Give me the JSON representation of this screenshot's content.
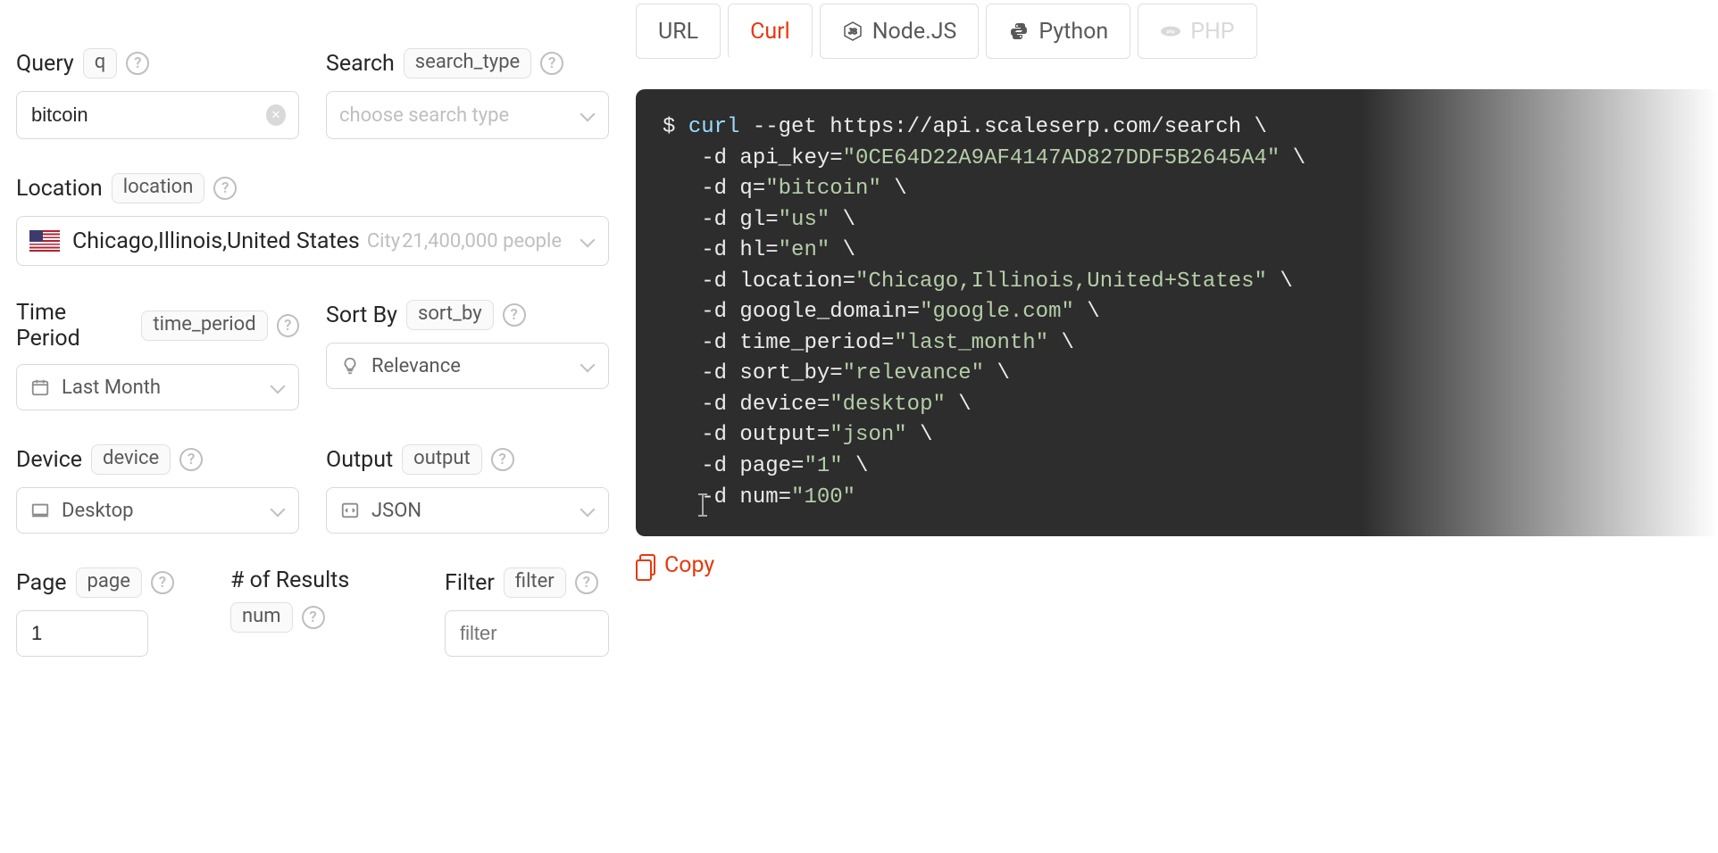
{
  "form": {
    "query": {
      "label": "Query",
      "param": "q",
      "value": "bitcoin"
    },
    "search": {
      "label": "Search",
      "param": "search_type",
      "placeholder": "choose search type"
    },
    "location": {
      "label": "Location",
      "param": "location",
      "name": "Chicago,Illinois,United States",
      "type": "City",
      "population": "21,400,000 people",
      "flag_icon": "us-flag"
    },
    "time_period": {
      "label": "Time Period",
      "param": "time_period",
      "value": "Last Month",
      "icon": "calendar-icon"
    },
    "sort_by": {
      "label": "Sort By",
      "param": "sort_by",
      "value": "Relevance",
      "icon": "bulb-icon"
    },
    "device": {
      "label": "Device",
      "param": "device",
      "value": "Desktop",
      "icon": "desktop-icon"
    },
    "output": {
      "label": "Output",
      "param": "output",
      "value": "JSON",
      "icon": "json-icon"
    },
    "page": {
      "label": "Page",
      "param": "page",
      "value": "1"
    },
    "results": {
      "label": "# of Results",
      "param": "num"
    },
    "filter": {
      "label": "Filter",
      "param": "filter",
      "placeholder": "filter"
    }
  },
  "tabs": [
    {
      "label": "URL",
      "icon": null,
      "active": false
    },
    {
      "label": "Curl",
      "icon": null,
      "active": true
    },
    {
      "label": "Node.JS",
      "icon": "nodejs-icon",
      "active": false
    },
    {
      "label": "Python",
      "icon": "python-icon",
      "active": false
    },
    {
      "label": "PHP",
      "icon": "php-icon",
      "active": false
    }
  ],
  "code": {
    "prompt": "$",
    "cmd": "curl",
    "url": "--get https://api.scaleserp.com/search \\",
    "params": [
      {
        "flag": "-d",
        "key": "api_key",
        "value": "0CE64D22A9AF4147AD827DDF5B2645A4"
      },
      {
        "flag": "-d",
        "key": "q",
        "value": "bitcoin"
      },
      {
        "flag": "-d",
        "key": "gl",
        "value": "us"
      },
      {
        "flag": "-d",
        "key": "hl",
        "value": "en"
      },
      {
        "flag": "-d",
        "key": "location",
        "value": "Chicago,Illinois,United+States"
      },
      {
        "flag": "-d",
        "key": "google_domain",
        "value": "google.com"
      },
      {
        "flag": "-d",
        "key": "time_period",
        "value": "last_month"
      },
      {
        "flag": "-d",
        "key": "sort_by",
        "value": "relevance"
      },
      {
        "flag": "-d",
        "key": "device",
        "value": "desktop"
      },
      {
        "flag": "-d",
        "key": "output",
        "value": "json"
      },
      {
        "flag": "-d",
        "key": "page",
        "value": "1"
      },
      {
        "flag": "-d",
        "key": "num",
        "value": "100"
      }
    ]
  },
  "copy_label": "Copy",
  "colors": {
    "accent": "#e8380d",
    "code_bg": "#2d2d2d",
    "string": "#b5cea8",
    "cmd": "#9cdcfe"
  }
}
